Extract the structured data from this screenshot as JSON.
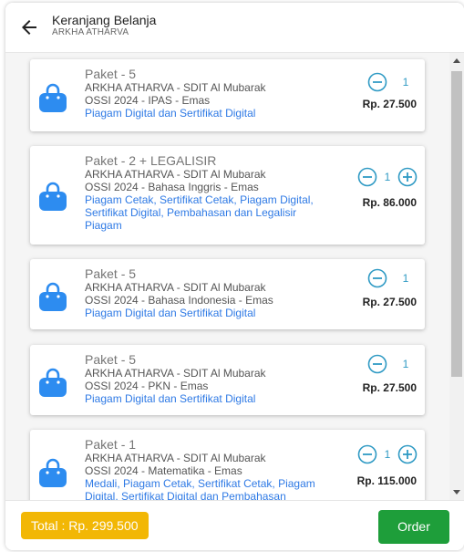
{
  "header": {
    "title": "Keranjang Belanja",
    "subtitle": "ARKHA ATHARVA"
  },
  "cart": {
    "items": [
      {
        "package": "Paket - 5",
        "student": "ARKHA ATHARVA - SDIT Al Mubarak",
        "event": "OSSI 2024 - IPAS - Emas",
        "contents": "Piagam Digital dan Sertifikat Digital",
        "quantity": "1",
        "price": "Rp. 27.500"
      },
      {
        "package": "Paket - 2 + LEGALISIR",
        "student": "ARKHA ATHARVA - SDIT Al Mubarak",
        "event": "OSSI 2024 - Bahasa Inggris - Emas",
        "contents": "Piagam Cetak, Sertifikat Cetak, Piagam Digital, Sertifikat Digital, Pembahasan dan Legalisir Piagam",
        "quantity": "1",
        "price": "Rp. 86.000"
      },
      {
        "package": "Paket - 5",
        "student": "ARKHA ATHARVA - SDIT Al Mubarak",
        "event": "OSSI 2024 - Bahasa Indonesia - Emas",
        "contents": "Piagam Digital dan Sertifikat Digital",
        "quantity": "1",
        "price": "Rp. 27.500"
      },
      {
        "package": "Paket - 5",
        "student": "ARKHA ATHARVA - SDIT Al Mubarak",
        "event": "OSSI 2024 - PKN - Emas",
        "contents": "Piagam Digital dan Sertifikat Digital",
        "quantity": "1",
        "price": "Rp. 27.500"
      },
      {
        "package": "Paket - 1",
        "student": "ARKHA ATHARVA - SDIT Al Mubarak",
        "event": "OSSI 2024 - Matematika - Emas",
        "contents": "Medali, Piagam Cetak, Sertifikat Cetak, Piagam Digital, Sertifikat Digital dan Pembahasan",
        "quantity": "1",
        "price": "Rp. 115.000"
      }
    ]
  },
  "footer": {
    "total_label": "Total : Rp. 299.500",
    "order_label": "Order"
  },
  "colors": {
    "accent_blue": "#2f7ae5",
    "icon_blue": "#2d8cf0",
    "stepper_teal": "#2f9ac4",
    "total_yellow": "#f2b705",
    "order_green": "#1e9e3a"
  },
  "icons": {
    "back": "arrow-left-icon",
    "item": "shopping-bag-icon",
    "decrease": "minus-circle-icon",
    "increase": "plus-circle-icon"
  }
}
